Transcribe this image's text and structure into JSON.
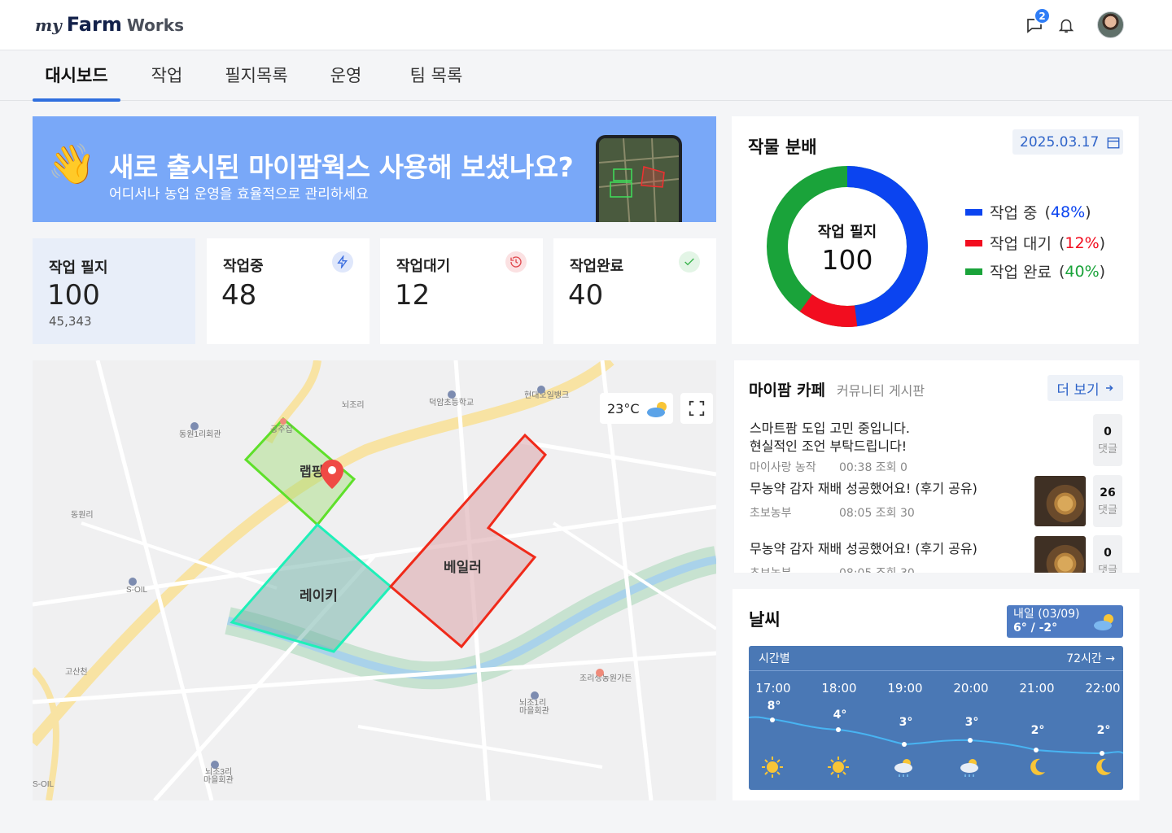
{
  "header": {
    "logo": {
      "my": "my",
      "farm": "Farm",
      "works": "Works"
    },
    "message_count": "2"
  },
  "tabs": [
    {
      "label": "대시보드",
      "active": true
    },
    {
      "label": "작업"
    },
    {
      "label": "필지목록"
    },
    {
      "label": "운영"
    },
    {
      "label": "팀 목록"
    }
  ],
  "banner": {
    "title": "새로 출시된 마이팜웍스 사용해 보셨나요?",
    "subtitle": "어디서나 농업 운영을 효율적으로 관리하세요",
    "emoji": "👋"
  },
  "stats": [
    {
      "label": "작업 필지",
      "value": "100",
      "sub": "45,343"
    },
    {
      "label": "작업중",
      "value": "48",
      "icon": "lightning-icon",
      "color": "#3a6de0"
    },
    {
      "label": "작업대기",
      "value": "12",
      "icon": "history-clock-icon",
      "color": "#e0474c"
    },
    {
      "label": "작업완료",
      "value": "40",
      "icon": "check-icon",
      "color": "#37b34a"
    }
  ],
  "map": {
    "weather": "23°C",
    "fields": [
      "랩핑기",
      "레이키",
      "베일러"
    ],
    "places": [
      "뇌조리",
      "덕암초등학교",
      "현대오일뱅크",
      "동원1리회관",
      "동원리",
      "S-OIL",
      "고산천",
      "조리생농원가든",
      "뇌조1리 마을회관",
      "뇌조3리 마을회관",
      "S-OIL",
      "공주집"
    ]
  },
  "crop": {
    "title": "작물 분배",
    "date": "2025.03.17",
    "center_label": "작업 필지",
    "center_value": "100",
    "legend": [
      {
        "label": "작업 중",
        "pct": "48%",
        "color": "#0b44f0"
      },
      {
        "label": "작업 대기",
        "pct": "12%",
        "color": "#f20d1f"
      },
      {
        "label": "작업 완료",
        "pct": "40%",
        "color": "#1aa33a"
      }
    ]
  },
  "cafe": {
    "title": "마이팜 카페",
    "subtitle": "커뮤니티 게시판",
    "more": "더 보기",
    "posts": [
      {
        "title_line1": "스마트팜 도입 고민 중입니다.",
        "title_line2": "현실적인 조언 부탁드립니다!",
        "author": "마이사랑 농작",
        "time": "00:38 조회 0",
        "comments": "0",
        "comments_label": "댓글"
      },
      {
        "title_line1": "무농약 감자 재배 성공했어요! (후기 공유)",
        "author": "초보농부",
        "time": "08:05 조회 30",
        "comments": "26",
        "comments_label": "댓글"
      },
      {
        "title_line1": "무농약 감자 재배 성공했어요! (후기 공유)",
        "author": "초보농부",
        "time": "08:05 조회 30",
        "comments": "0",
        "comments_label": "댓글"
      }
    ]
  },
  "weather": {
    "title": "날씨",
    "tomorrow_label": "내일 (03/09)",
    "tomorrow_temp": "6° / -2°",
    "panel_label": "시간별",
    "panel_more": "72시간",
    "hours": [
      {
        "time": "17:00",
        "temp": "8°",
        "icon": "sun-icon"
      },
      {
        "time": "18:00",
        "temp": "4°",
        "icon": "sun-icon"
      },
      {
        "time": "19:00",
        "temp": "3°",
        "icon": "cloud-rain-icon"
      },
      {
        "time": "20:00",
        "temp": "3°",
        "icon": "cloud-rain-icon"
      },
      {
        "time": "21:00",
        "temp": "2°",
        "icon": "moon-icon"
      },
      {
        "time": "22:00",
        "temp": "2°",
        "icon": "moon-icon"
      }
    ]
  }
}
